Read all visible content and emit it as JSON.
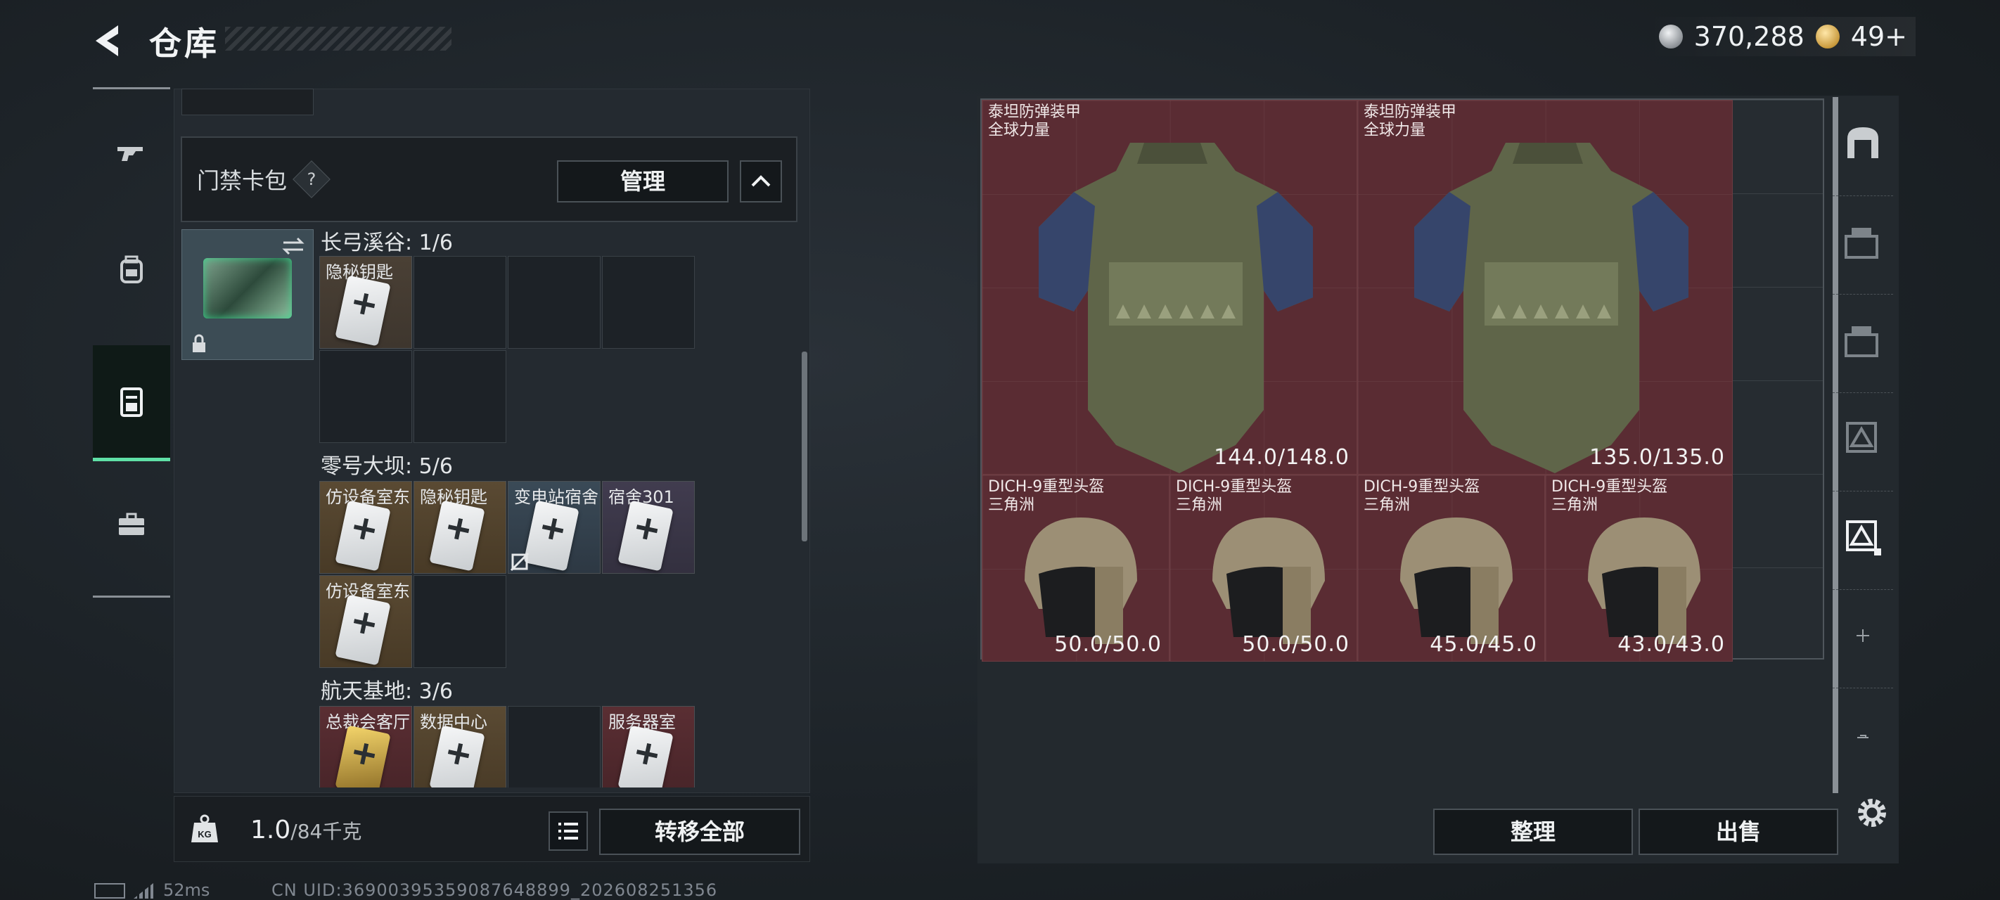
{
  "header": {
    "title": "仓库"
  },
  "currency": {
    "silver": "370,288",
    "gold": "49+"
  },
  "leftnav": {
    "items": [
      "weapon-icon",
      "backpack-icon",
      "keycard-case-icon",
      "toolbox-icon"
    ]
  },
  "keycard_panel": {
    "label": "门禁卡包",
    "help": "?",
    "manage": "管理",
    "zones": [
      {
        "title": "长弓溪谷: 1/6",
        "keys": [
          "隐秘钥匙"
        ]
      },
      {
        "title": "零号大坝: 5/6",
        "keys": [
          "仿设备室东",
          "隐秘钥匙",
          "变电站宿舍",
          "宿舍301",
          "仿设备室东"
        ]
      },
      {
        "title": "航天基地: 3/6",
        "keys": [
          "总裁会客厅",
          "数据中心",
          "服务器室"
        ]
      }
    ]
  },
  "bottom": {
    "weight_value": "1.0",
    "weight_max": "/84千克",
    "transfer_all": "转移全部",
    "kg": "KG"
  },
  "stash": {
    "armors": [
      {
        "name": "泰坦防弹装甲",
        "brand": "全球力量",
        "durability": "144.0/148.0"
      },
      {
        "name": "泰坦防弹装甲",
        "brand": "全球力量",
        "durability": "135.0/135.0"
      }
    ],
    "helmets": [
      {
        "name": "DICH-9重型头盔",
        "brand": "三角洲",
        "durability": "50.0/50.0"
      },
      {
        "name": "DICH-9重型头盔",
        "brand": "三角洲",
        "durability": "50.0/50.0"
      },
      {
        "name": "DICH-9重型头盔",
        "brand": "三角洲",
        "durability": "45.0/45.0"
      },
      {
        "name": "DICH-9重型头盔",
        "brand": "三角洲",
        "durability": "43.0/43.0"
      }
    ],
    "sort": "整理",
    "sell": "出售"
  },
  "status": {
    "ping": "52ms",
    "uid": "CN UID:36900395359087648899_202608251356"
  }
}
